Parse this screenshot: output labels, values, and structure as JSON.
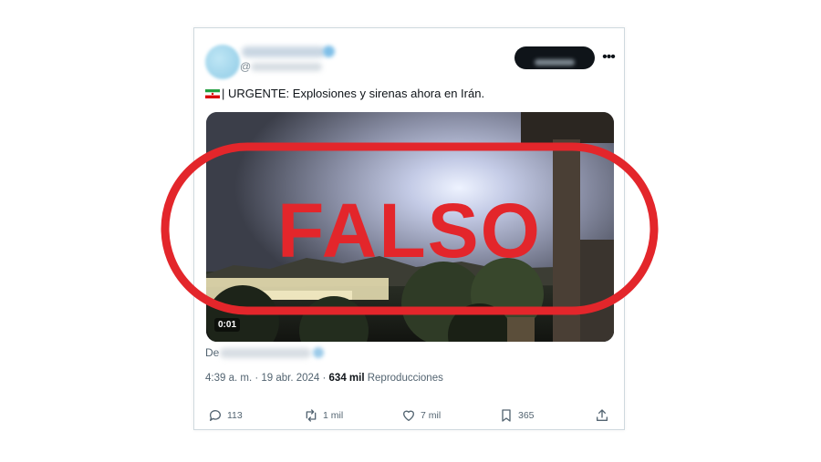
{
  "tweet": {
    "handle_prefix": "@",
    "text": "| URGENTE: Explosiones y sirenas ahora en Irán.",
    "flag_icon": "iran-flag-icon",
    "video": {
      "time": "0:01"
    },
    "source_prefix": "De",
    "timestamp": "4:39 a. m. · 19 abr. 2024 · ",
    "views_count": "634 mil",
    "views_label": "Reproducciones",
    "actions": {
      "replies": "113",
      "reposts": "1 mil",
      "likes": "7 mil",
      "bookmarks": "365"
    }
  },
  "stamp": {
    "label": "FALSO",
    "color": "#e3262b"
  }
}
